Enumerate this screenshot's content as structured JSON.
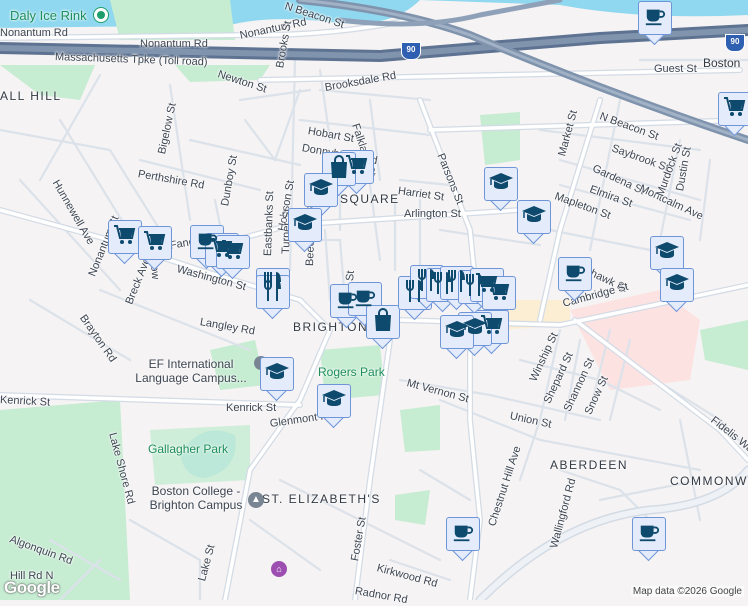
{
  "map": {
    "colors": {
      "water": "#8fd8ef",
      "park": "#c6ecd2",
      "road": "#ffffff",
      "road_outline": "#d7dee7",
      "highway": "#7388a4",
      "hospital": "#fde2e2",
      "marker_bg": "#e4ecfb",
      "marker_border": "#6f95d9",
      "marker_icon": "#0e4a6e"
    },
    "streets": [
      "Nonantum Rd",
      "Nonantum Rd",
      "Nonantum Rd",
      "Massachusetts Tpke (Toll road)",
      "N Beacon St",
      "N Beacon St",
      "Newton St",
      "Brooks St",
      "Brooksdale Rd",
      "Falkland St",
      "Hobart St",
      "Bigelow St",
      "Perthshire Rd",
      "Dunboy St",
      "Hobson St",
      "Hunnewell Ave",
      "Bigelow",
      "Faneuil St",
      "Faneuil St",
      "Harriet St",
      "Arlington St",
      "Parsons St",
      "Market St",
      "Guest St",
      "Saybrook St",
      "Gardena St",
      "Elmira St",
      "Montcalm Ave",
      "Murdock St",
      "Dustin St",
      "Mapleton St",
      "Sparhawk St",
      "Cambridge St",
      "Washington St",
      "Nonantum St",
      "Breck Ave",
      "Brayton Rd",
      "Langley Rd",
      "Beechcroft St",
      "Turner St",
      "Eastbanks St",
      "Kenrick St",
      "Kenrick St",
      "Glenmont Rd",
      "Lake Shore Rd",
      "Mt Vernon St",
      "Union St",
      "Winship St",
      "Shepard St",
      "Shannon St",
      "Snow St",
      "Chestnut Hill Ave",
      "Wallingford Rd",
      "Fidelis Way",
      "Foster St",
      "Kirkwood Rd",
      "Radnor Rd",
      "Algonquin Rd",
      "Lake St",
      "Hill Rd N",
      "Donnybrook Rd",
      "St"
    ],
    "neighborhoods": [
      "ALL HILL",
      "SQUARE",
      "BRIGHTON",
      "ABERDEEN",
      "COMMONW",
      "ST. ELIZABETH'S",
      "Boston"
    ],
    "parks": [
      "Rogers Park",
      "Gallagher Park"
    ],
    "pois": {
      "ice_rink": "Daly Ice Rink",
      "ef": "EF International Language Campus...",
      "bc": "Boston College - Brighton Campus"
    },
    "highway_shield": "90",
    "markers": [
      {
        "type": "coffee"
      },
      {
        "type": "grocery"
      },
      {
        "type": "grocery"
      },
      {
        "type": "shopping"
      },
      {
        "type": "education"
      },
      {
        "type": "education"
      },
      {
        "type": "education"
      },
      {
        "type": "education"
      },
      {
        "type": "grocery"
      },
      {
        "type": "grocery"
      },
      {
        "type": "coffee"
      },
      {
        "type": "grocery"
      },
      {
        "type": "grocery"
      },
      {
        "type": "restaurant"
      },
      {
        "type": "restaurant"
      },
      {
        "type": "coffee"
      },
      {
        "type": "coffee"
      },
      {
        "type": "shopping"
      },
      {
        "type": "restaurant"
      },
      {
        "type": "restaurant"
      },
      {
        "type": "restaurant"
      },
      {
        "type": "restaurant"
      },
      {
        "type": "restaurant"
      },
      {
        "type": "grocery"
      },
      {
        "type": "grocery"
      },
      {
        "type": "coffee"
      },
      {
        "type": "education"
      },
      {
        "type": "education"
      },
      {
        "type": "grocery"
      },
      {
        "type": "education"
      },
      {
        "type": "education"
      },
      {
        "type": "education"
      },
      {
        "type": "coffee"
      },
      {
        "type": "education"
      },
      {
        "type": "coffee"
      }
    ],
    "attribution": "Map data ©2026 Google",
    "logo": "Google"
  }
}
